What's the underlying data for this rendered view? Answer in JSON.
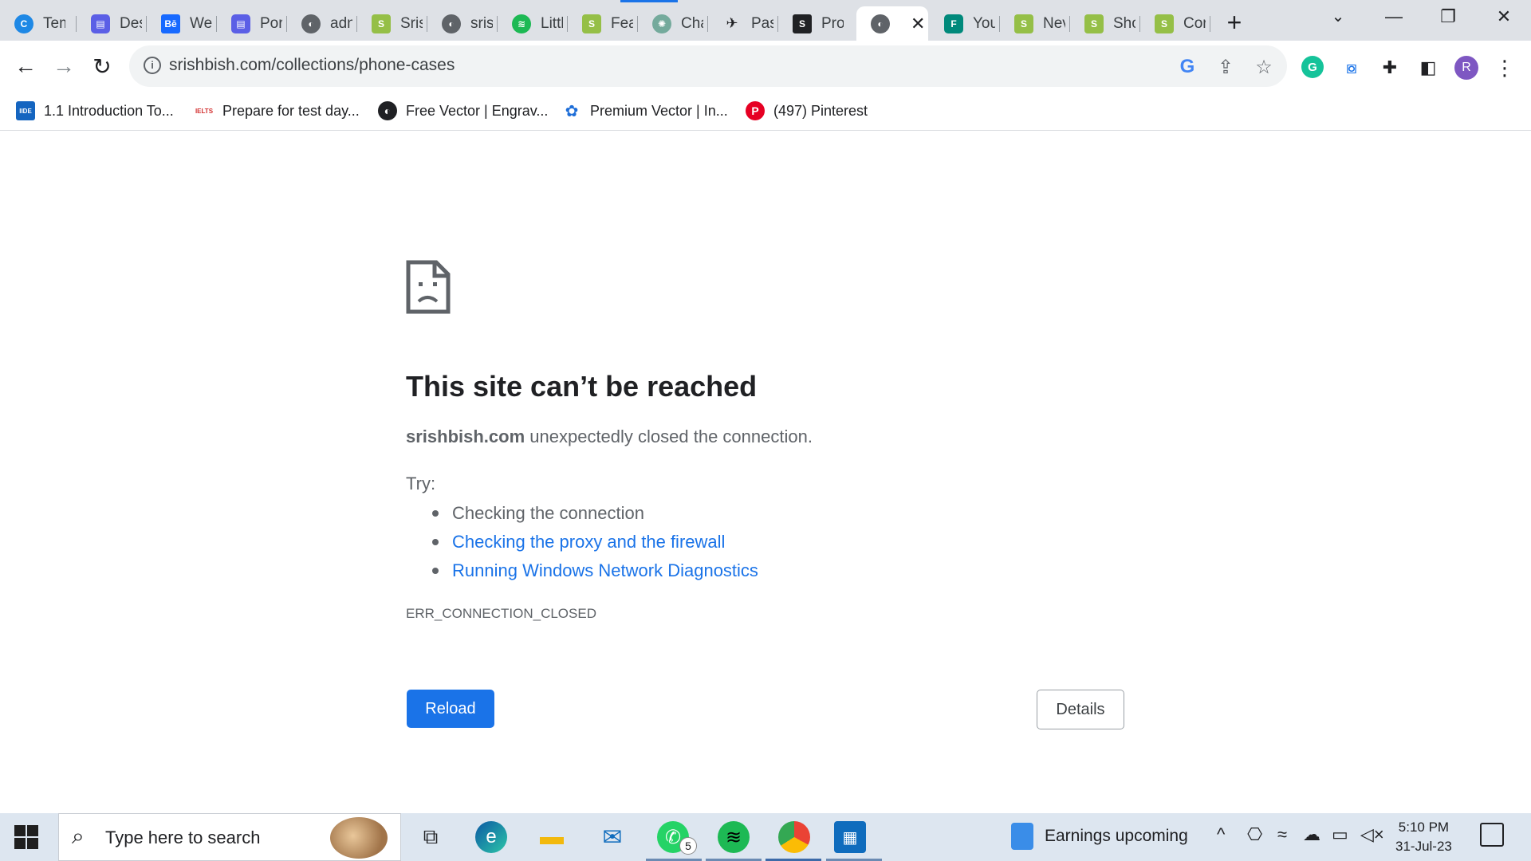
{
  "tabs": [
    {
      "title": "Tem",
      "icon": "canva-icon",
      "color": "#1e88e5"
    },
    {
      "title": "Des",
      "icon": "printer-app-icon",
      "color": "#5b5fe6"
    },
    {
      "title": "We",
      "icon": "behance-icon",
      "color": "#1769ff"
    },
    {
      "title": "Por",
      "icon": "printer-app-icon",
      "color": "#5b5fe6"
    },
    {
      "title": "adn",
      "icon": "globe-icon",
      "color": "#5f6368"
    },
    {
      "title": "Sris",
      "icon": "shopify-icon",
      "color": "#95bf47"
    },
    {
      "title": "sris",
      "icon": "globe-icon",
      "color": "#5f6368"
    },
    {
      "title": "Littl",
      "icon": "spotify-icon",
      "color": "#1db954"
    },
    {
      "title": "Fea",
      "icon": "shopify-icon",
      "color": "#95bf47"
    },
    {
      "title": "Cha",
      "icon": "chatgpt-icon",
      "color": "#74aa9c"
    },
    {
      "title": "Pas",
      "icon": "bird-icon",
      "color": "#202124"
    },
    {
      "title": "Pro",
      "icon": "squarespace-icon",
      "color": "#202124"
    },
    {
      "title": "",
      "icon": "globe-icon",
      "color": "#5f6368",
      "active": true
    },
    {
      "title": "You",
      "icon": "app-icon",
      "color": "#00897b"
    },
    {
      "title": "Nev",
      "icon": "shopify-icon",
      "color": "#95bf47"
    },
    {
      "title": "Sho",
      "icon": "shopify-icon",
      "color": "#95bf47"
    },
    {
      "title": "Cor",
      "icon": "shopify-icon",
      "color": "#95bf47"
    }
  ],
  "toolbar": {
    "url": "srishbish.com/collections/phone-cases",
    "profile_initial": "R"
  },
  "bookmarks": [
    {
      "label": "1.1 Introduction To...",
      "icon": "iide-icon",
      "icon_text": "IIDE",
      "color": "#1565c0"
    },
    {
      "label": "Prepare for test day...",
      "icon": "ielts-icon",
      "icon_text": "IELTS",
      "color": "#d32f2f"
    },
    {
      "label": "Free Vector | Engrav...",
      "icon": "globe-icon",
      "icon_text": "",
      "color": "#202124"
    },
    {
      "label": "Premium Vector | In...",
      "icon": "freepik-icon",
      "icon_text": "",
      "color": "#1e6ed8"
    },
    {
      "label": "(497) Pinterest",
      "icon": "pinterest-icon",
      "icon_text": "P",
      "color": "#e60023"
    }
  ],
  "error": {
    "title": "This site can’t be reached",
    "host": "srishbish.com",
    "message": " unexpectedly closed the connection.",
    "try_label": "Try:",
    "suggestions": [
      "Checking the connection",
      "Checking the proxy and the firewall",
      "Running Windows Network Diagnostics"
    ],
    "code": "ERR_CONNECTION_CLOSED",
    "reload_label": "Reload",
    "details_label": "Details"
  },
  "taskbar": {
    "search_placeholder": "Type here to search",
    "whatsapp_badge": "5",
    "news_text": "Earnings upcoming",
    "time": "5:10 PM",
    "date": "31-Jul-23"
  }
}
